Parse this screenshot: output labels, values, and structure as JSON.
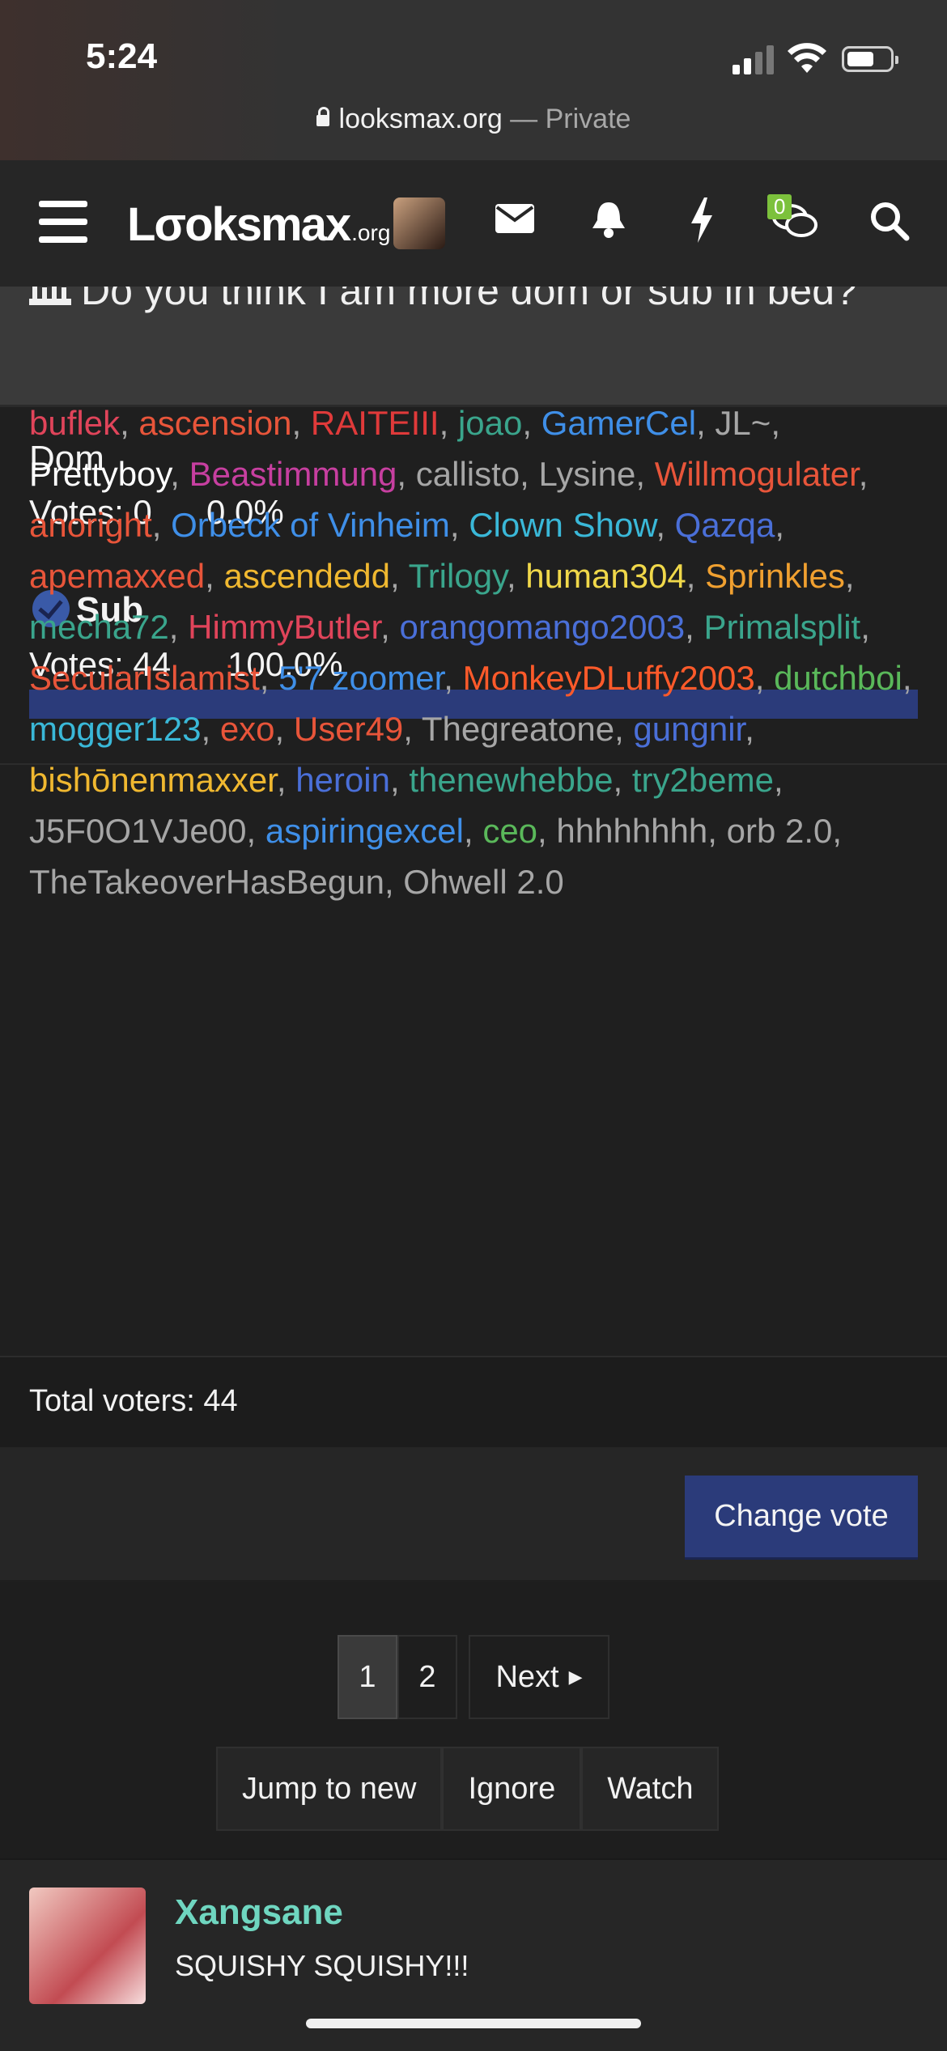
{
  "status_bar": {
    "time": "5:24",
    "url": "looksmax.org",
    "url_suffix": " — Private"
  },
  "nav": {
    "logo": "Lσoksmax",
    "logo_org": ".org",
    "icons": [
      "menu-icon",
      "mail-icon",
      "bell-icon",
      "bolt-icon",
      "chat-icon",
      "search-icon"
    ],
    "chat_badge": "0"
  },
  "thread": {
    "title": "Do you think I am more dom or sub in bed?"
  },
  "poll": {
    "options": [
      {
        "label": "Dom",
        "votes": "Votes: 0",
        "percent": "0.0%",
        "fraction": 0,
        "selected": false
      },
      {
        "label": "Sub",
        "votes": "Votes: 44",
        "percent": "100.0%",
        "fraction": 1.0,
        "selected": true
      }
    ],
    "bar_color": "#2b3b7a",
    "voters": [
      {
        "name": "buflek",
        "color": "#e0445a"
      },
      {
        "name": "ascension",
        "color": "#e8553a"
      },
      {
        "name": "RAITEIII",
        "color": "#e03a3a"
      },
      {
        "name": "joao",
        "color": "#3aa58c"
      },
      {
        "name": "GamerCel",
        "color": "#3f8fe8"
      },
      {
        "name": "JL~",
        "color": "#a6a6a6"
      },
      {
        "name": "Prettyboy",
        "color": "#ffffff"
      },
      {
        "name": "Beastimmung",
        "color": "#c73fa0"
      },
      {
        "name": "callisto",
        "color": "#a6a6a6"
      },
      {
        "name": "Lysine",
        "color": "#a6a6a6"
      },
      {
        "name": "Willmogulater",
        "color": "#e8553a"
      },
      {
        "name": "anoright",
        "color": "#e8553a"
      },
      {
        "name": "Orbeck of Vinheim",
        "color": "#3f8fe8"
      },
      {
        "name": "Clown Show",
        "color": "#3ab8d8"
      },
      {
        "name": "Qazqa",
        "color": "#4a6fd8"
      },
      {
        "name": "apemaxxed",
        "color": "#e8553a"
      },
      {
        "name": "ascendedd",
        "color": "#f0b830"
      },
      {
        "name": "Trilogy",
        "color": "#3aa58c"
      },
      {
        "name": "human304",
        "color": "#f0d84a"
      },
      {
        "name": "Sprinkles",
        "color": "#f0a030"
      },
      {
        "name": "mecha72",
        "color": "#3aa58c"
      },
      {
        "name": "HimmyButler",
        "color": "#e0445a"
      },
      {
        "name": "orangomango2003",
        "color": "#4a6fd8"
      },
      {
        "name": "Primalsplit",
        "color": "#3aa58c"
      },
      {
        "name": "SecularIslamist",
        "color": "#e8553a"
      },
      {
        "name": "5'7 zoomer",
        "color": "#3f8fe8"
      },
      {
        "name": "MonkeyDLuffy2003",
        "color": "#ff5a2a"
      },
      {
        "name": "dutchboi",
        "color": "#5ab85a"
      },
      {
        "name": "mogger123",
        "color": "#3ab8d8"
      },
      {
        "name": "exo",
        "color": "#e8553a"
      },
      {
        "name": "User49",
        "color": "#e8553a"
      },
      {
        "name": "Thegreatone",
        "color": "#a6a6a6"
      },
      {
        "name": "gungnir",
        "color": "#4a6fd8"
      },
      {
        "name": "bishōnenmaxxer",
        "color": "#f0b830"
      },
      {
        "name": "heroin",
        "color": "#4a6fd8"
      },
      {
        "name": "thenewhebbe",
        "color": "#3aa58c"
      },
      {
        "name": "try2beme",
        "color": "#3aa58c"
      },
      {
        "name": "J5F0O1VJe00",
        "color": "#a6a6a6"
      },
      {
        "name": "aspiringexcel",
        "color": "#3f8fe8"
      },
      {
        "name": "ceo",
        "color": "#5ab85a"
      },
      {
        "name": "hhhhhhhh",
        "color": "#a6a6a6"
      },
      {
        "name": "orb 2.0",
        "color": "#a6a6a6"
      },
      {
        "name": "TheTakeoverHasBegun",
        "color": "#a6a6a6"
      },
      {
        "name": "Ohwell 2.0",
        "color": "#a6a6a6"
      }
    ],
    "total_voters": "Total voters: 44",
    "change_vote_label": "Change vote"
  },
  "pagination": {
    "pages": [
      "1",
      "2"
    ],
    "current": "1",
    "next_label": "Next"
  },
  "thread_actions": [
    "Jump to new",
    "Ignore",
    "Watch"
  ],
  "post": {
    "username": "Xangsane",
    "username_color": "#6fd6c0",
    "text": "SQUISHY SQUISHY!!!"
  }
}
